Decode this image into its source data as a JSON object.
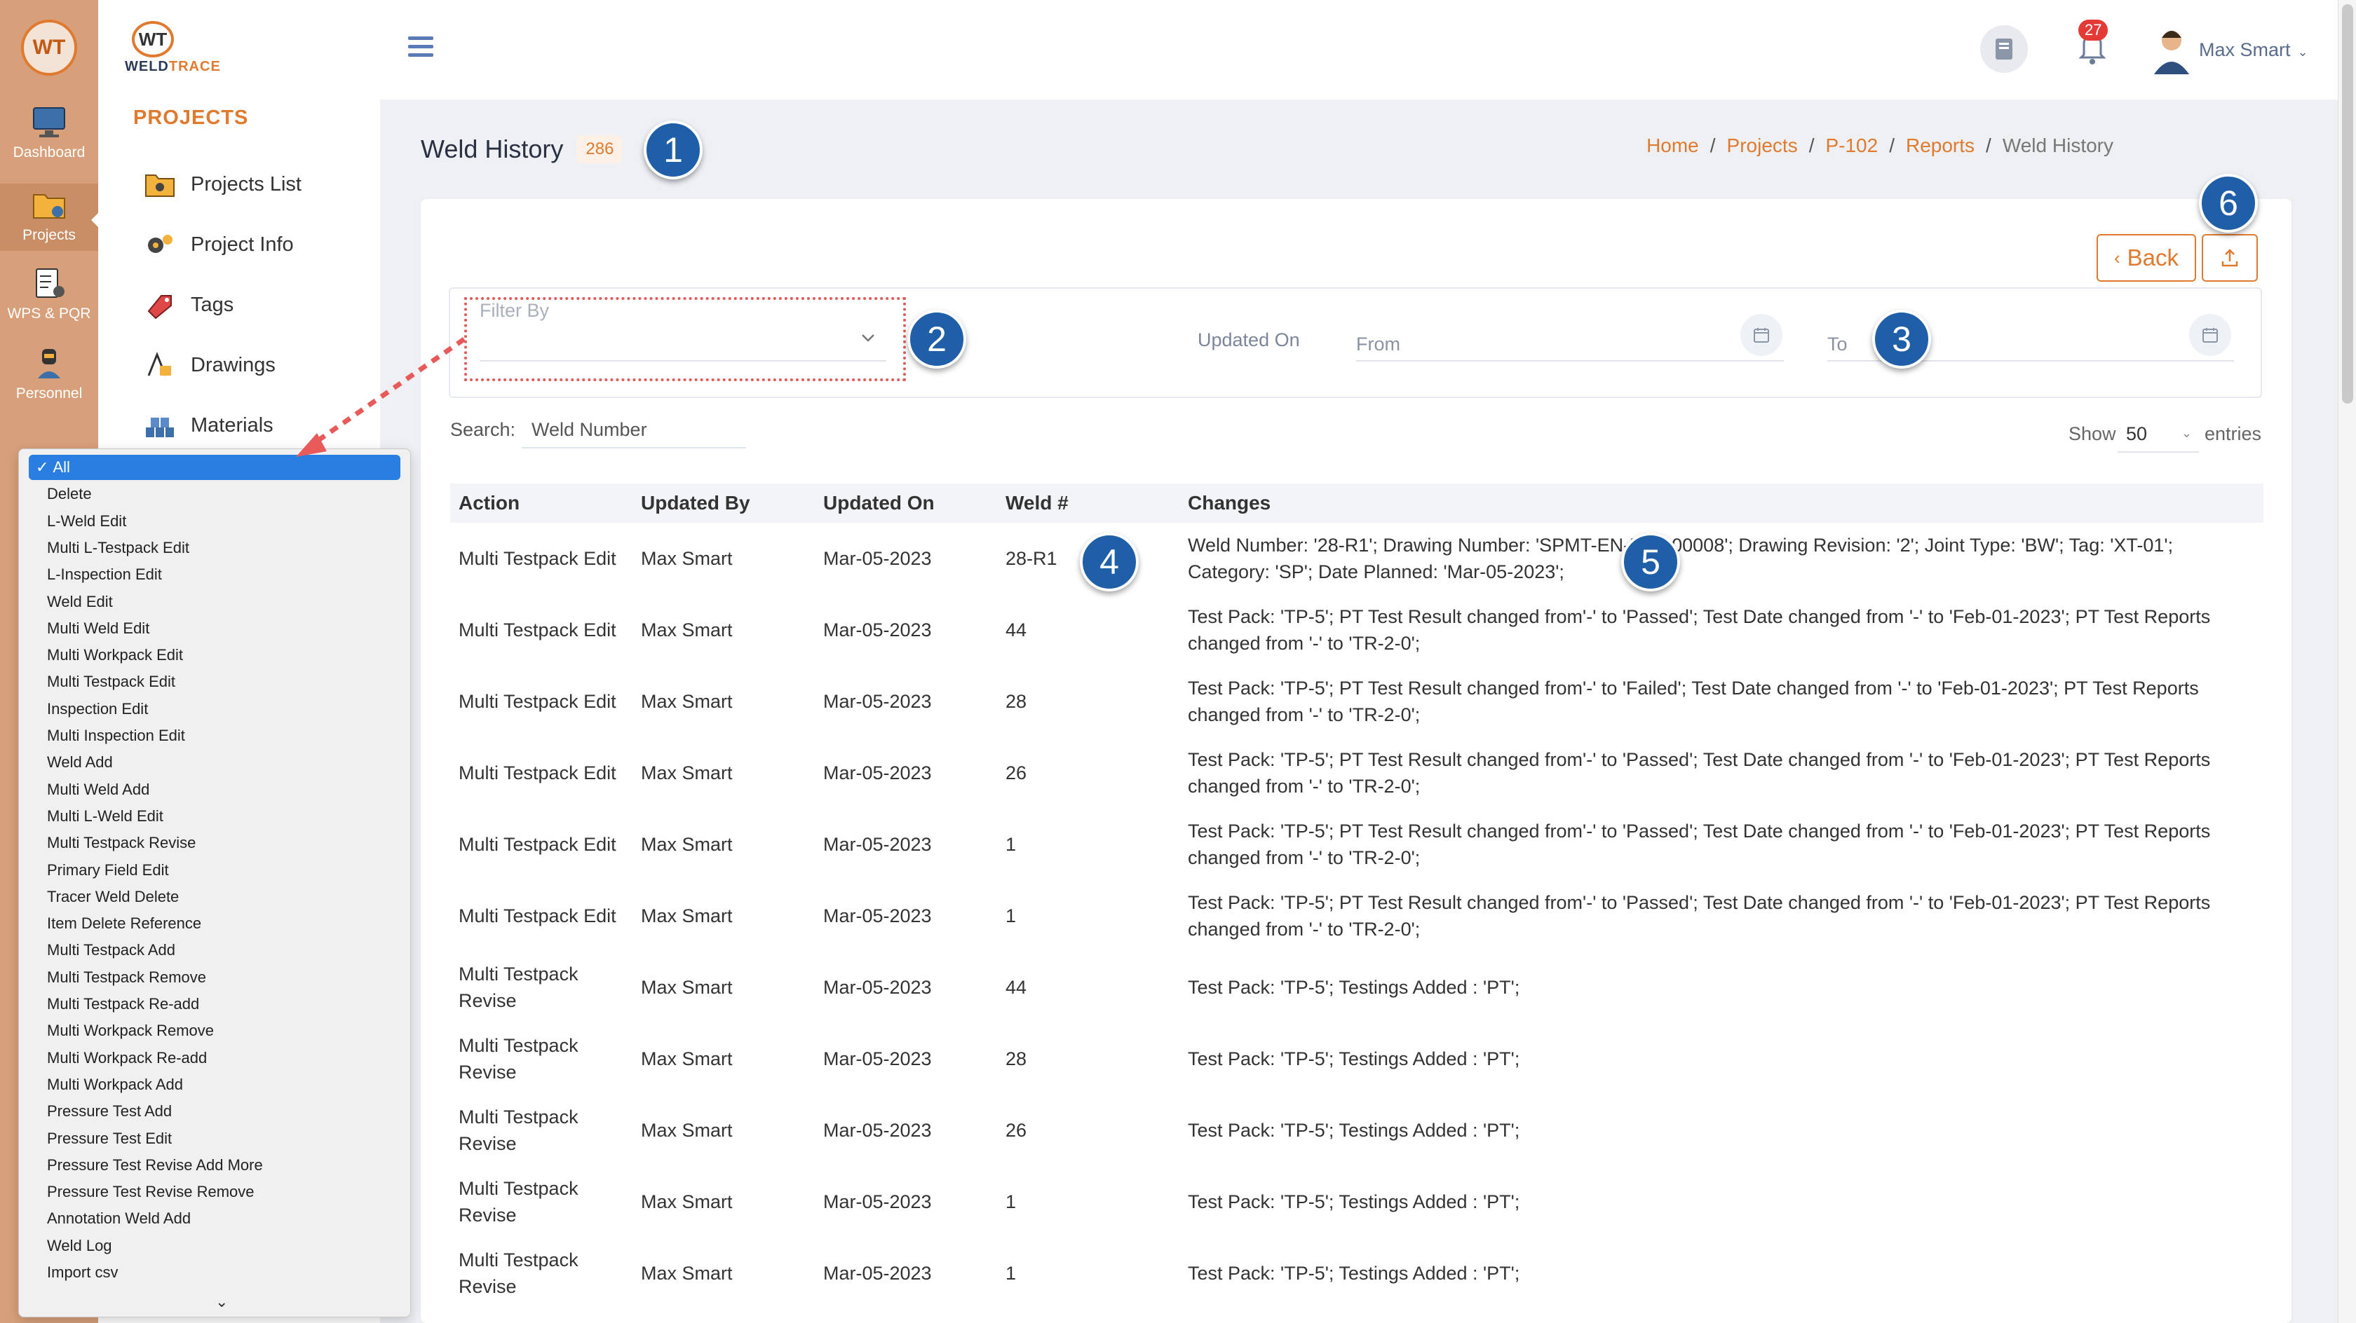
{
  "rail": {
    "items": [
      {
        "label": "Dashboard"
      },
      {
        "label": "Projects"
      },
      {
        "label": "WPS & PQR"
      },
      {
        "label": "Personnel"
      }
    ]
  },
  "brand": {
    "mark": "WT",
    "name_a": "WELD",
    "name_b": "TRACE"
  },
  "sidebar": {
    "section": "PROJECTS",
    "items": [
      {
        "label": "Projects List"
      },
      {
        "label": "Project Info"
      },
      {
        "label": "Tags"
      },
      {
        "label": "Drawings"
      },
      {
        "label": "Materials"
      }
    ]
  },
  "header": {
    "notifications": "27",
    "user": "Max Smart"
  },
  "page": {
    "title": "Weld History",
    "count": "286"
  },
  "breadcrumb": [
    "Home",
    "Projects",
    "P-102",
    "Reports",
    "Weld History"
  ],
  "toolbar": {
    "back": "Back"
  },
  "filters": {
    "filter_by": "Filter By",
    "updated_on": "Updated On",
    "from": "From",
    "to": "To",
    "search_label": "Search:",
    "search_value": "Weld Number",
    "show": "Show",
    "entries_value": "50",
    "entries": "entries"
  },
  "table": {
    "headers": [
      "Action",
      "Updated By",
      "Updated On",
      "Weld #",
      "Changes"
    ],
    "rows": [
      {
        "action": "Multi Testpack Edit",
        "by": "Max Smart",
        "on": "Mar-05-2023",
        "weld": "28-R1",
        "changes": "Weld Number: '28-R1'; Drawing Number: 'SPMT-EN-DRG00008'; Drawing Revision: '2'; Joint Type: 'BW'; Tag: 'XT-01'; Category: 'SP'; Date Planned: 'Mar-05-2023';"
      },
      {
        "action": "Multi Testpack Edit",
        "by": "Max Smart",
        "on": "Mar-05-2023",
        "weld": "44",
        "changes": "Test Pack: 'TP-5'; PT Test Result changed from'-' to 'Passed'; Test Date changed from '-' to 'Feb-01-2023'; PT Test Reports changed from '-' to 'TR-2-0';"
      },
      {
        "action": "Multi Testpack Edit",
        "by": "Max Smart",
        "on": "Mar-05-2023",
        "weld": "28",
        "changes": "Test Pack: 'TP-5'; PT Test Result changed from'-' to 'Failed'; Test Date changed from '-' to 'Feb-01-2023'; PT Test Reports changed from '-' to 'TR-2-0';"
      },
      {
        "action": "Multi Testpack Edit",
        "by": "Max Smart",
        "on": "Mar-05-2023",
        "weld": "26",
        "changes": "Test Pack: 'TP-5'; PT Test Result changed from'-' to 'Passed'; Test Date changed from '-' to 'Feb-01-2023'; PT Test Reports changed from '-' to 'TR-2-0';"
      },
      {
        "action": "Multi Testpack Edit",
        "by": "Max Smart",
        "on": "Mar-05-2023",
        "weld": "1",
        "changes": "Test Pack: 'TP-5'; PT Test Result changed from'-' to 'Passed'; Test Date changed from '-' to 'Feb-01-2023'; PT Test Reports changed from '-' to 'TR-2-0';"
      },
      {
        "action": "Multi Testpack Edit",
        "by": "Max Smart",
        "on": "Mar-05-2023",
        "weld": "1",
        "changes": "Test Pack: 'TP-5'; PT Test Result changed from'-' to 'Passed'; Test Date changed from '-' to 'Feb-01-2023'; PT Test Reports changed from '-' to 'TR-2-0';"
      },
      {
        "action": "Multi Testpack Revise",
        "by": "Max Smart",
        "on": "Mar-05-2023",
        "weld": "44",
        "changes": "Test Pack: 'TP-5'; Testings Added : 'PT';"
      },
      {
        "action": "Multi Testpack Revise",
        "by": "Max Smart",
        "on": "Mar-05-2023",
        "weld": "28",
        "changes": "Test Pack: 'TP-5'; Testings Added : 'PT';"
      },
      {
        "action": "Multi Testpack Revise",
        "by": "Max Smart",
        "on": "Mar-05-2023",
        "weld": "26",
        "changes": "Test Pack: 'TP-5'; Testings Added : 'PT';"
      },
      {
        "action": "Multi Testpack Revise",
        "by": "Max Smart",
        "on": "Mar-05-2023",
        "weld": "1",
        "changes": "Test Pack: 'TP-5'; Testings Added : 'PT';"
      },
      {
        "action": "Multi Testpack Revise",
        "by": "Max Smart",
        "on": "Mar-05-2023",
        "weld": "1",
        "changes": "Test Pack: 'TP-5'; Testings Added : 'PT';"
      }
    ]
  },
  "dropdown": {
    "selected_mark": "✓",
    "options": [
      "All",
      "Delete",
      "L-Weld Edit",
      "Multi L-Testpack Edit",
      "L-Inspection Edit",
      "Weld Edit",
      "Multi Weld Edit",
      "Multi Workpack Edit",
      "Multi Testpack Edit",
      "Inspection Edit",
      "Multi Inspection Edit",
      "Weld Add",
      "Multi Weld Add",
      "Multi L-Weld Edit",
      "Multi Testpack Revise",
      "Primary Field Edit",
      "Tracer Weld Delete",
      "Item Delete Reference",
      "Multi Testpack Add",
      "Multi Testpack Remove",
      "Multi Testpack Re-add",
      "Multi Workpack Remove",
      "Multi Workpack Re-add",
      "Multi Workpack Add",
      "Pressure Test Add",
      "Pressure Test Edit",
      "Pressure Test Revise Add More",
      "Pressure Test Revise Remove",
      "Annotation Weld Add",
      "Weld Log",
      "Import csv"
    ]
  },
  "callouts": [
    "1",
    "2",
    "3",
    "4",
    "5",
    "6"
  ],
  "colors": {
    "accent": "#e07a2e",
    "callout": "#1f5fa8",
    "rail": "#d8a07a",
    "select": "#2a7de1"
  }
}
